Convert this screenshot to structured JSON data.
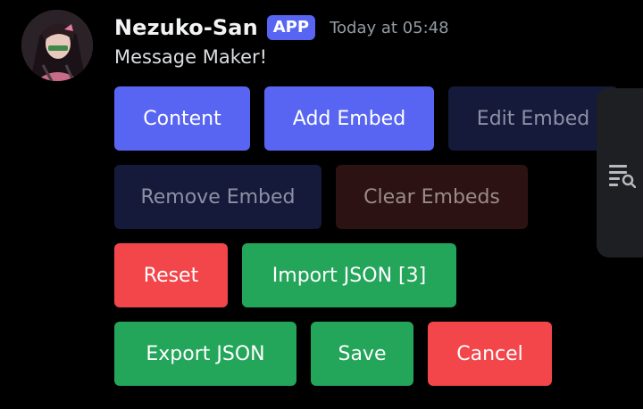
{
  "message": {
    "author": "Nezuko-San",
    "badge": "APP",
    "timestamp": "Today at 05:48",
    "content": "Message Maker!"
  },
  "buttons": {
    "content": "Content",
    "add_embed": "Add Embed",
    "edit_embed": "Edit Embed",
    "remove_embed": "Remove Embed",
    "clear_embeds": "Clear Embeds",
    "reset": "Reset",
    "import_json": "Import JSON [3]",
    "export_json": "Export JSON",
    "save": "Save",
    "cancel": "Cancel"
  },
  "icons": {
    "side_panel": "search-list-icon"
  },
  "colors": {
    "primary": "#5865f2",
    "success": "#23a55a",
    "danger": "#f2464b"
  }
}
